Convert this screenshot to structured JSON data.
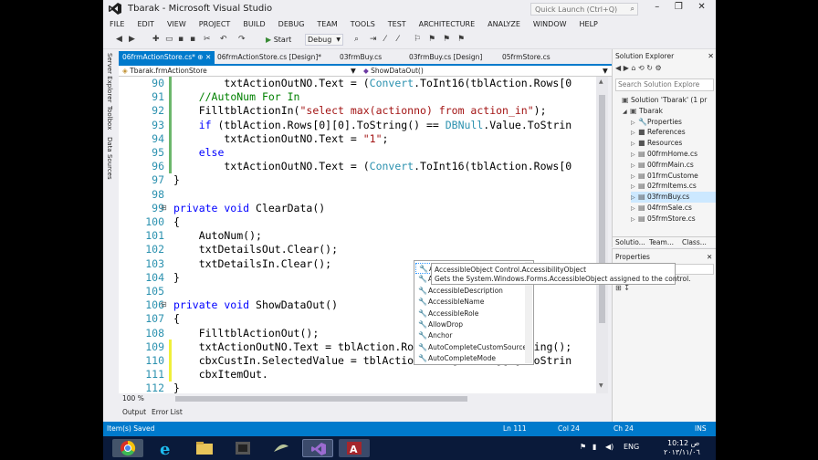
{
  "window": {
    "title": "Tbarak - Microsoft Visual Studio",
    "quick_launch": "Quick Launch (Ctrl+Q)",
    "controls": [
      "–",
      "❐",
      "✕"
    ]
  },
  "menu": [
    "FILE",
    "EDIT",
    "VIEW",
    "PROJECT",
    "BUILD",
    "DEBUG",
    "TEAM",
    "TOOLS",
    "TEST",
    "ARCHITECTURE",
    "ANALYZE",
    "WINDOW",
    "HELP"
  ],
  "toolbar": {
    "start_label": "Start",
    "config": "Debug"
  },
  "side_strip": [
    "Server Explorer",
    "Toolbox",
    "Data Sources"
  ],
  "tabs": [
    {
      "label": "06frmActionStore.cs*  ⊕ ✕",
      "active": true
    },
    {
      "label": "06frmActionStore.cs [Design]*",
      "active": false
    },
    {
      "label": "03frmBuy.cs",
      "active": false
    },
    {
      "label": "03frmBuy.cs [Design]",
      "active": false
    },
    {
      "label": "05frmStore.cs",
      "active": false
    }
  ],
  "nav": {
    "class": "Tbarak.frmActionStore",
    "member": "ShowDataOut()"
  },
  "code_lines": [
    {
      "n": "90",
      "html": "        txtActionOutNO.Text = (<span class=\"ct\">Convert</span>.ToInt16(tblAction.Rows[0"
    },
    {
      "n": "91",
      "html": "    <span class=\"cc\">//AutoNum For In</span>"
    },
    {
      "n": "92",
      "html": "    FilltblActionIn(<span class=\"cs\">\"select max(actionno) from action_in\"</span>);"
    },
    {
      "n": "93",
      "html": "    <span class=\"cb\">if</span> (tblAction.Rows[0][0].ToString() == <span class=\"ct\">DBNull</span>.Value.ToStrin"
    },
    {
      "n": "94",
      "html": "        txtActionOutNO.Text = <span class=\"cs\">\"1\"</span>;"
    },
    {
      "n": "95",
      "html": "    <span class=\"cb\">else</span>"
    },
    {
      "n": "96",
      "html": "        txtActionOutNO.Text = (<span class=\"ct\">Convert</span>.ToInt16(tblAction.Rows[0"
    },
    {
      "n": "97",
      "html": "}"
    },
    {
      "n": "98",
      "html": ""
    },
    {
      "n": "99",
      "html": "<span class=\"cb\">private void</span> ClearData()"
    },
    {
      "n": "100",
      "html": "{"
    },
    {
      "n": "101",
      "html": "    AutoNum();"
    },
    {
      "n": "102",
      "html": "    txtDetailsOut.Clear();"
    },
    {
      "n": "103",
      "html": "    txtDetailsIn.Clear();"
    },
    {
      "n": "104",
      "html": "}"
    },
    {
      "n": "105",
      "html": ""
    },
    {
      "n": "106",
      "html": "<span class=\"cb\">private void</span> ShowDataOut()"
    },
    {
      "n": "107",
      "html": "{"
    },
    {
      "n": "108",
      "html": "    FilltblActionOut();"
    },
    {
      "n": "109",
      "html": "    txtActionOutNO.Text = tblAction.Rows[intRow][0].ToString();"
    },
    {
      "n": "110",
      "html": "    cbxCustIn.SelectedValue = tblAction.Rows[intRow][1].ToStrin"
    },
    {
      "n": "111",
      "html": "    cbxItemOut."
    },
    {
      "n": "112",
      "html": "}"
    }
  ],
  "autocomplete": {
    "items": [
      "AccessibilityObject",
      "AccessibleDefaultActionDescr",
      "AccessibleDescription",
      "AccessibleName",
      "AccessibleRole",
      "AllowDrop",
      "Anchor",
      "AutoCompleteCustomSource",
      "AutoCompleteMode"
    ],
    "selected": 0,
    "tooltip_line1": "AccessibleObject Control.AccessibilityObject",
    "tooltip_line2": "Gets the System.Windows.Forms.AccessibleObject assigned to the control."
  },
  "editor_status": {
    "zoom": "100 %"
  },
  "bottom_tabs": [
    "Output",
    "Error List"
  ],
  "status": {
    "message": "Item(s) Saved",
    "ln": "Ln 111",
    "col": "Col 24",
    "ch": "Ch 24",
    "mode": "INS"
  },
  "solution_explorer": {
    "title": "Solution Explorer",
    "search_placeholder": "Search Solution Explore",
    "nodes": [
      {
        "label": "Solution 'Tbarak' (1 pr",
        "indent": 0,
        "arrow": "",
        "icon": "▣"
      },
      {
        "label": "Tbarak",
        "indent": 1,
        "arrow": "◢",
        "icon": "▣"
      },
      {
        "label": "Properties",
        "indent": 2,
        "arrow": "▷",
        "icon": "🔧"
      },
      {
        "label": "References",
        "indent": 2,
        "arrow": "▷",
        "icon": "■"
      },
      {
        "label": "Resources",
        "indent": 2,
        "arrow": "▷",
        "icon": "■"
      },
      {
        "label": "00frmHome.cs",
        "indent": 2,
        "arrow": "▷",
        "icon": "▤"
      },
      {
        "label": "00frmMain.cs",
        "indent": 2,
        "arrow": "▷",
        "icon": "▤"
      },
      {
        "label": "01frmCustome",
        "indent": 2,
        "arrow": "▷",
        "icon": "▤"
      },
      {
        "label": "02frmItems.cs",
        "indent": 2,
        "arrow": "▷",
        "icon": "▤"
      },
      {
        "label": "03frmBuy.cs",
        "indent": 2,
        "arrow": "▷",
        "icon": "▤",
        "selected": true
      },
      {
        "label": "04frmSale.cs",
        "indent": 2,
        "arrow": "▷",
        "icon": "▤"
      },
      {
        "label": "05frmStore.cs",
        "indent": 2,
        "arrow": "▷",
        "icon": "▤"
      }
    ],
    "tabs": [
      "Solutio...",
      "Team...",
      "Class..."
    ]
  },
  "properties": {
    "title": "Properties"
  },
  "tray": {
    "lang": "ENG",
    "time": "10:12 ص",
    "date": "٢٠١٣/١١/٠٦"
  },
  "colors": {
    "accent": "#007acc",
    "taskbar": "#0a1a3a"
  }
}
